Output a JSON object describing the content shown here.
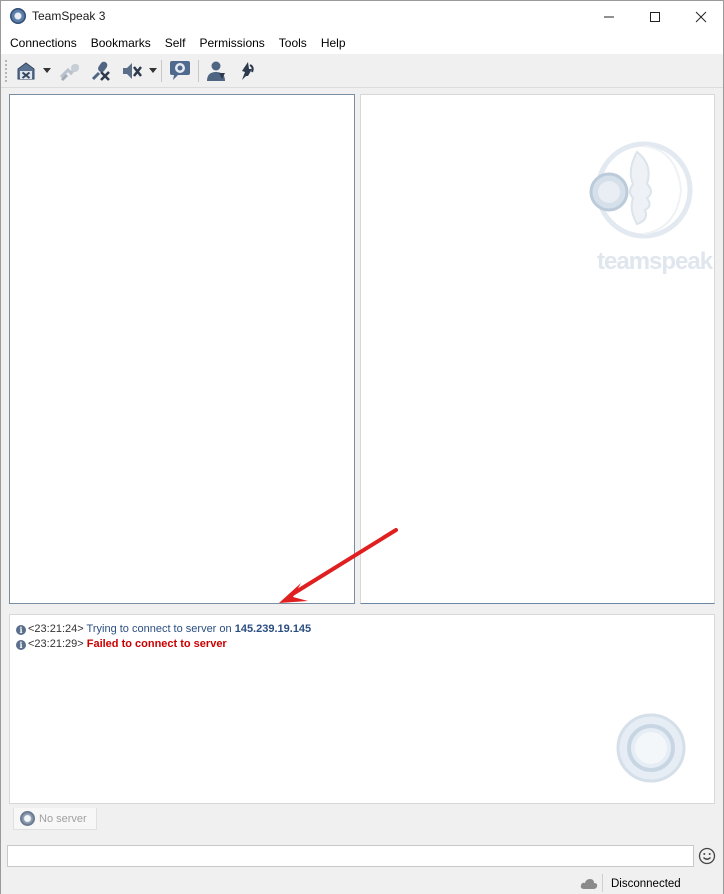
{
  "window": {
    "title": "TeamSpeak 3"
  },
  "menu": [
    "Connections",
    "Bookmarks",
    "Self",
    "Permissions",
    "Tools",
    "Help"
  ],
  "toolbar": {
    "icons": [
      "disconnect-icon",
      "away-icon",
      "mute-microphone-icon",
      "mute-speakers-icon",
      "chat-icon",
      "contacts-icon",
      "whisper-icon"
    ]
  },
  "logo": {
    "wordmark": "teamspeak"
  },
  "log": [
    {
      "time": "<23:21:24>",
      "text": "Trying to connect to server on",
      "value": "145.239.19.145",
      "type": "info"
    },
    {
      "time": "<23:21:29>",
      "text": "Failed to connect to server",
      "type": "error"
    }
  ],
  "tabs": [
    {
      "label": "No server"
    }
  ],
  "chat": {
    "value": "",
    "placeholder": ""
  },
  "status": {
    "connection": "Disconnected"
  },
  "colors": {
    "error": "#cc0000",
    "info": "#2b4f82",
    "annotation": "#e02020"
  }
}
